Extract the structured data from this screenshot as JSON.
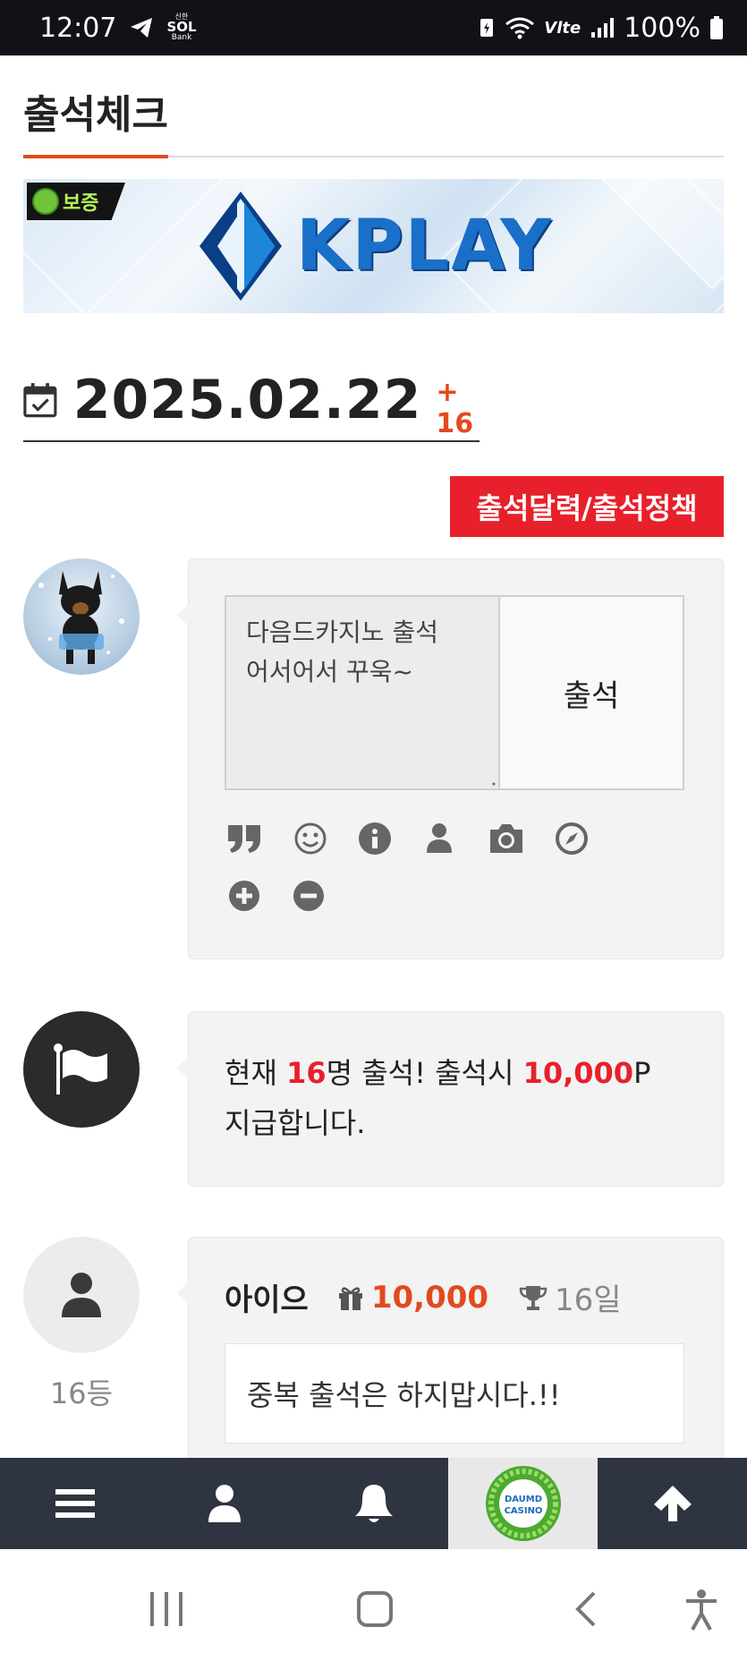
{
  "status_bar": {
    "time": "12:07",
    "bank_top": "신한",
    "bank_logo": "SOL",
    "bank_bottom": "Bank",
    "network": "Vlte",
    "battery": "100%"
  },
  "page": {
    "title": "출석체크"
  },
  "banner": {
    "badge_text": "보증",
    "brand": "KPLAY"
  },
  "date": {
    "value": "2025.02.22",
    "plus": "+ 16"
  },
  "policy_button": "출석달력/출석정책",
  "compose": {
    "text_line1": "다음드카지노 출석",
    "text_line2": "어서어서 꾸욱~",
    "submit": "출석"
  },
  "toolbar_icons": [
    "quote-icon",
    "smile-icon",
    "info-icon",
    "user-icon",
    "camera-icon",
    "compass-icon",
    "plus-circle-icon",
    "minus-circle-icon"
  ],
  "notice": {
    "prefix": "현재 ",
    "count": "16",
    "middle": "명 출석! 출석시 ",
    "points": "10,000",
    "suffix": "P",
    "line2": "지급합니다."
  },
  "entry": {
    "name": "아이으",
    "points": "10,000",
    "days": "16일",
    "message": "중복 출석은 하지맙시다.!!",
    "rank": "16등"
  },
  "bottom_nav": {
    "casino_label_top": "DAUMD",
    "casino_label_bottom": "CASINO"
  },
  "colors": {
    "accent_orange": "#e24a1f",
    "accent_red": "#e8202b",
    "nav_bg": "#2e3540",
    "panel_bg": "#f3f3f3"
  }
}
